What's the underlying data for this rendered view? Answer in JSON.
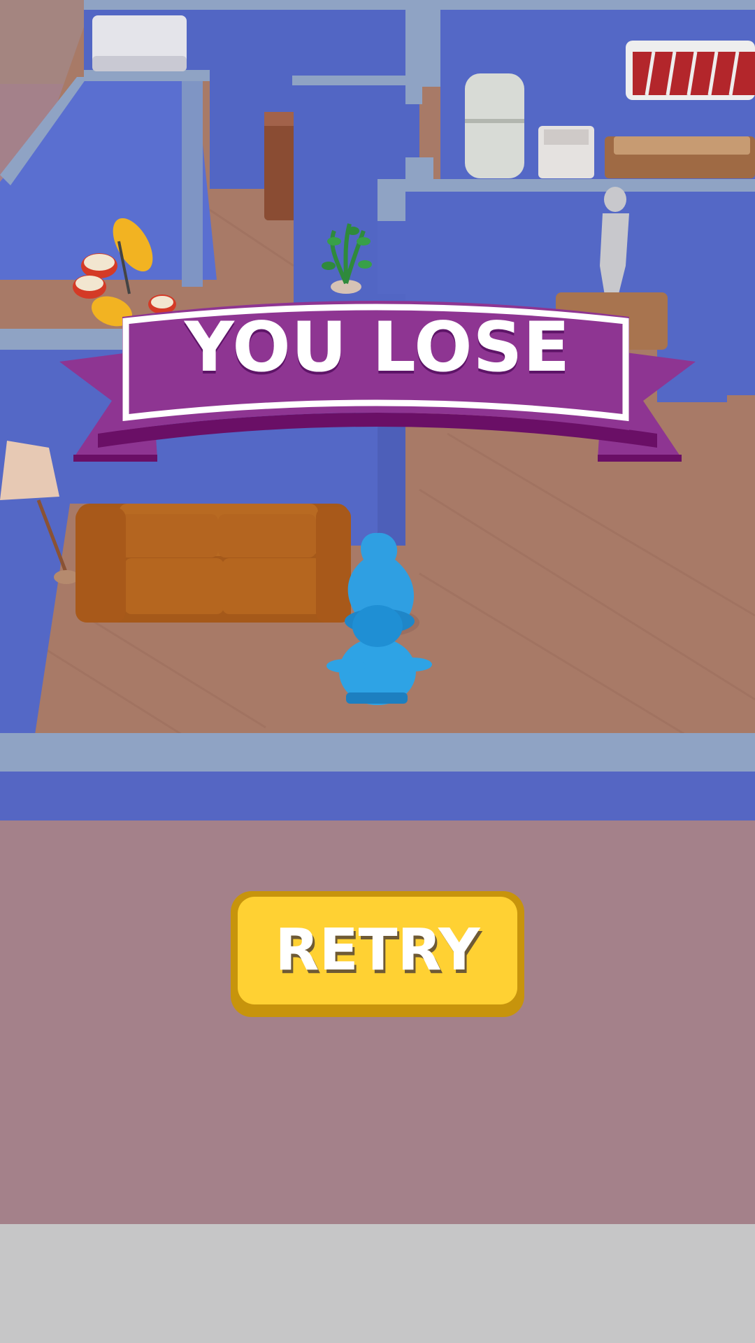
{
  "result_banner": {
    "title": "YOU LOSE",
    "ribbon_color": "#8e3592",
    "ribbon_dark_color": "#6a0f66",
    "text_color": "#ffffff"
  },
  "retry_button": {
    "label": "RETRY",
    "fill_color": "#ffd133",
    "border_color": "#c7940c"
  },
  "scene": {
    "wall_color": "#5566c4",
    "wall_top_color": "#8fa3c4",
    "floor_color": "#a77a68",
    "background_color": "#a3808a",
    "player_color": "#2fa8e6",
    "sofa_color": "#b5651a",
    "icons": [
      "player-character-icon",
      "sofa-icon",
      "drum-kit-icon",
      "fridge-icon",
      "plant-icon",
      "floor-lamp-icon",
      "npc-figure-icon"
    ]
  }
}
